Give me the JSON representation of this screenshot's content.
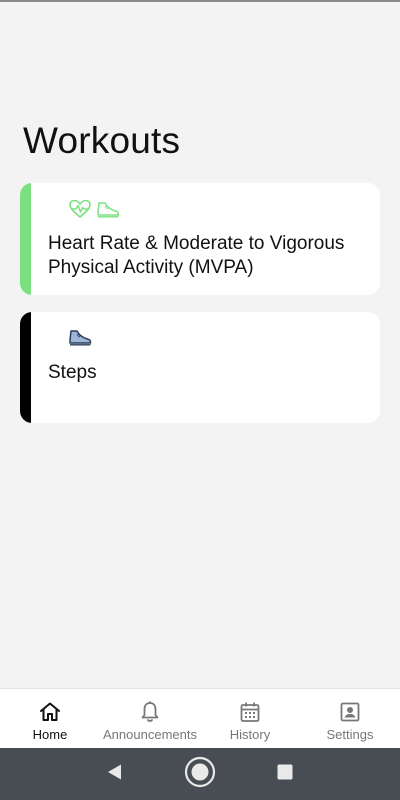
{
  "page": {
    "title": "Workouts"
  },
  "workouts": [
    {
      "title": "Heart Rate & Moderate to Vigorous Physical Activity (MVPA)",
      "accent_color": "#7be07f",
      "icons": [
        "heart-rate-icon",
        "sneaker-icon"
      ]
    },
    {
      "title": "Steps",
      "accent_color": "#000000",
      "icons": [
        "sneaker-icon"
      ]
    }
  ],
  "bottom_nav": {
    "active": "Home",
    "items": [
      {
        "label": "Home",
        "icon": "home-icon"
      },
      {
        "label": "Announcements",
        "icon": "bell-icon"
      },
      {
        "label": "History",
        "icon": "calendar-icon"
      },
      {
        "label": "Settings",
        "icon": "account-box-icon"
      }
    ]
  },
  "system_nav": {
    "icons": [
      "back-icon",
      "home-circle-icon",
      "recents-icon"
    ]
  },
  "colors": {
    "background": "#f3f3f3",
    "card": "#ffffff",
    "mvpa_accent": "#7be07f",
    "steps_accent": "#000000",
    "system_bar": "#474d52"
  }
}
